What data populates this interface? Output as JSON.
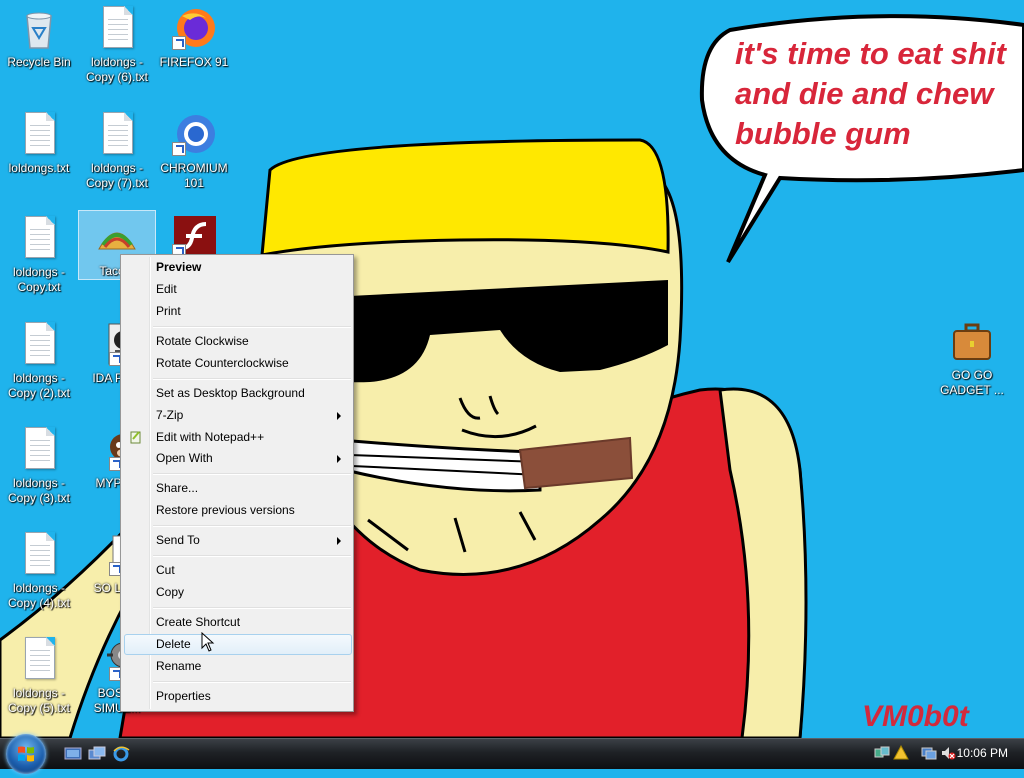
{
  "wallpaper": {
    "speech_lines": [
      "it's time to eat shit",
      "and die and chew",
      "bubble gum"
    ],
    "signature": "VM0b0t"
  },
  "desktop_icons": [
    {
      "label": "Recycle Bin"
    },
    {
      "label": "loldongs - Copy (6).txt"
    },
    {
      "label": "FIREFOX 91"
    },
    {
      "label": "loldongs.txt"
    },
    {
      "label": "loldongs - Copy (7).txt"
    },
    {
      "label": "CHROMIUM 101"
    },
    {
      "label": "loldongs - Copy.txt"
    },
    {
      "label": "Taco..."
    },
    {
      "label": "loldongs - Copy (2).txt"
    },
    {
      "label": "IDA PR..."
    },
    {
      "label": "loldongs - Copy (3).txt"
    },
    {
      "label": "MYPA..."
    },
    {
      "label": "loldongs - Copy (4).txt"
    },
    {
      "label": "SO LIT..."
    },
    {
      "label": "loldongs - Copy (5).txt"
    },
    {
      "label": "BOSI... SIMUL..."
    },
    {
      "label": "GO GO GADGET ..."
    }
  ],
  "context_menu": {
    "items": [
      {
        "label": "Preview"
      },
      {
        "label": "Edit"
      },
      {
        "label": "Print"
      },
      {
        "label": "Rotate Clockwise"
      },
      {
        "label": "Rotate Counterclockwise"
      },
      {
        "label": "Set as Desktop Background"
      },
      {
        "label": "7-Zip"
      },
      {
        "label": "Edit with Notepad++"
      },
      {
        "label": "Open With"
      },
      {
        "label": "Share..."
      },
      {
        "label": "Restore previous versions"
      },
      {
        "label": "Send To"
      },
      {
        "label": "Cut"
      },
      {
        "label": "Copy"
      },
      {
        "label": "Create Shortcut"
      },
      {
        "label": "Delete"
      },
      {
        "label": "Rename"
      },
      {
        "label": "Properties"
      }
    ],
    "hovered": "Delete"
  },
  "taskbar": {
    "clock": "10:06 PM"
  },
  "colors": {
    "desktop_bg": "#1fb3ec",
    "speech_text": "#d8263a",
    "menu_bg": "#f0f0f0",
    "hover_border": "#a8d1ee"
  }
}
